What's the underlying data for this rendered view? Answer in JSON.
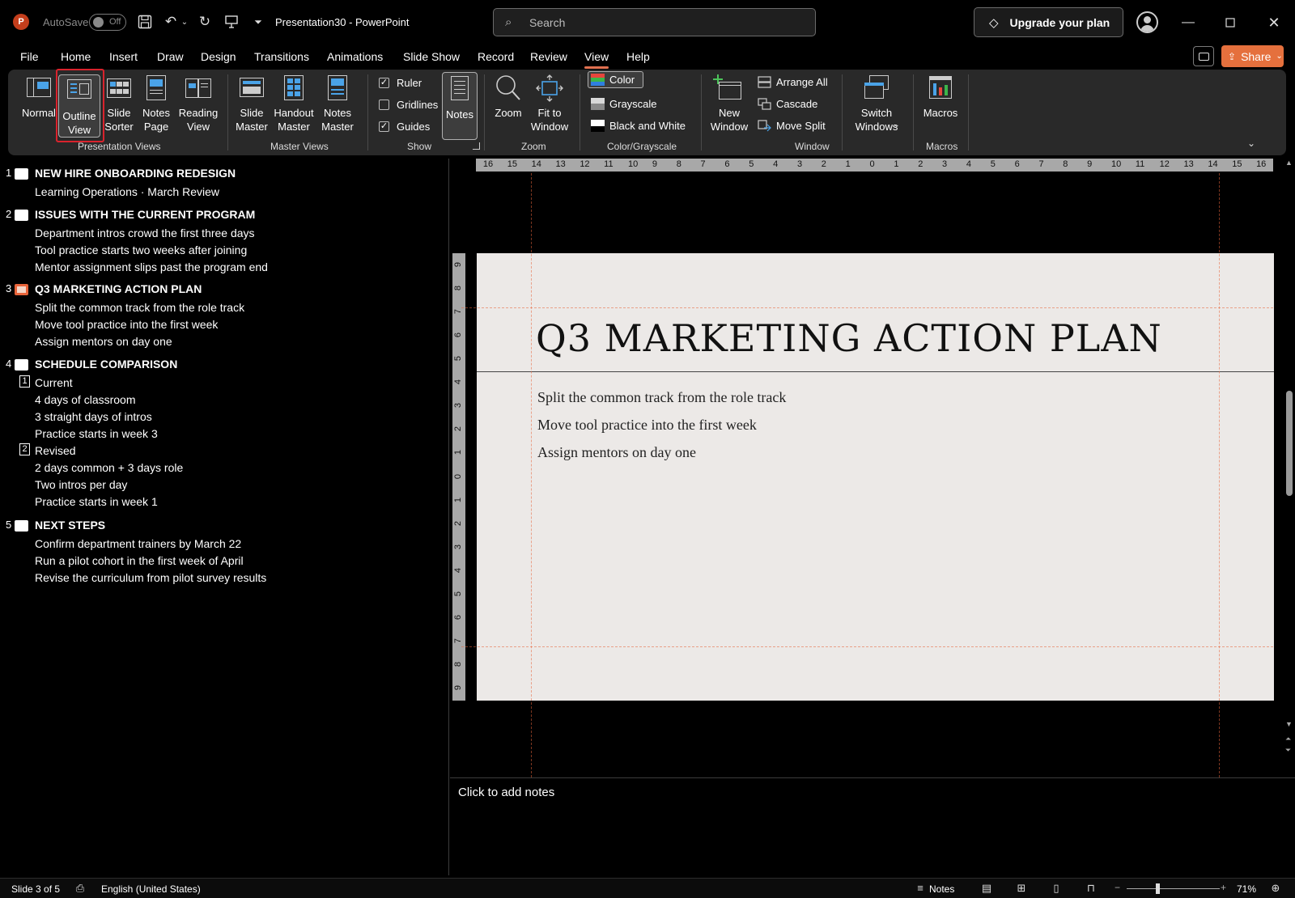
{
  "titlebar": {
    "app_badge": "P",
    "autosave_label": "AutoSave",
    "autosave_state": "Off",
    "document_title": "Presentation30  -  PowerPoint",
    "search_placeholder": "Search",
    "upgrade_label": "Upgrade your plan",
    "icons": [
      "save-icon",
      "undo-icon",
      "redo-icon",
      "present-icon",
      "customize-qat-icon",
      "search-icon",
      "diamond-icon",
      "avatar",
      "minimize-icon",
      "maximize-icon",
      "close-icon"
    ]
  },
  "menu": {
    "tabs": [
      "File",
      "Home",
      "Insert",
      "Draw",
      "Design",
      "Transitions",
      "Animations",
      "Slide Show",
      "Record",
      "Review",
      "View",
      "Help"
    ],
    "active_tab": "View",
    "share_label": "Share"
  },
  "ribbon": {
    "presentation_views": {
      "label": "Presentation Views",
      "normal": "Normal",
      "outline": [
        "Outline",
        "View"
      ],
      "slide_sorter": [
        "Slide",
        "Sorter"
      ],
      "notes_page": [
        "Notes",
        "Page"
      ],
      "reading_view": [
        "Reading",
        "View"
      ]
    },
    "master_views": {
      "label": "Master Views",
      "slide_master": [
        "Slide",
        "Master"
      ],
      "handout_master": [
        "Handout",
        "Master"
      ],
      "notes_master": [
        "Notes",
        "Master"
      ]
    },
    "show": {
      "label": "Show",
      "ruler": "Ruler",
      "ruler_checked": true,
      "gridlines": "Gridlines",
      "gridlines_checked": false,
      "guides": "Guides",
      "guides_checked": true,
      "notes": "Notes"
    },
    "zoom": {
      "label": "Zoom",
      "zoom": "Zoom",
      "fit_to_window": [
        "Fit to",
        "Window"
      ]
    },
    "color": {
      "label": "Color/Grayscale",
      "color": "Color",
      "grayscale": "Grayscale",
      "black_white": "Black and White"
    },
    "window": {
      "label": "Window",
      "new_window": [
        "New",
        "Window"
      ],
      "arrange_all": "Arrange All",
      "cascade": "Cascade",
      "move_split": "Move Split",
      "switch_windows": [
        "Switch",
        "Windows"
      ]
    },
    "macros": {
      "label": "Macros",
      "macros": "Macros"
    }
  },
  "outline": {
    "slides": [
      {
        "num": "1",
        "title": "NEW HIRE ONBOARDING REDESIGN",
        "lines": [
          "Learning Operations · March Review"
        ]
      },
      {
        "num": "2",
        "title": "ISSUES WITH THE CURRENT PROGRAM",
        "lines": [
          "Department intros crowd the first three days",
          "Tool practice starts two weeks after joining",
          "Mentor assignment slips past the program end"
        ]
      },
      {
        "num": "3",
        "title": "Q3 MARKETING ACTION PLAN",
        "lines": [
          "Split the common track from the role track",
          "Move tool practice into the first week",
          "Assign mentors on day one"
        ]
      },
      {
        "num": "4",
        "title": "SCHEDULE COMPARISON",
        "box1": "1",
        "group1_title": "Current",
        "group1_lines": [
          "4 days of classroom",
          "3 straight days of intros",
          "Practice starts in week 3"
        ],
        "box2": "2",
        "group2_title": "Revised",
        "group2_lines": [
          "2 days common + 3 days role",
          "Two intros per day",
          "Practice starts in week 1"
        ]
      },
      {
        "num": "5",
        "title": "NEXT STEPS",
        "lines": [
          "Confirm department trainers by March 22",
          "Run a pilot cohort in the first week of April",
          "Revise the curriculum from pilot survey results"
        ]
      }
    ]
  },
  "slide": {
    "title": "Q3 MARKETING ACTION PLAN",
    "bullets": [
      "Split the common track from the role track",
      "Move tool practice into the first week",
      "Assign mentors on day one"
    ]
  },
  "rulers": {
    "horizontal": [
      "16",
      "15",
      "14",
      "13",
      "12",
      "11",
      "10",
      "9",
      "8",
      "7",
      "6",
      "5",
      "4",
      "3",
      "2",
      "1",
      "0",
      "1",
      "2",
      "3",
      "4",
      "5",
      "6",
      "7",
      "8",
      "9",
      "10",
      "11",
      "12",
      "13",
      "14",
      "15",
      "16"
    ],
    "vertical": [
      "9",
      "8",
      "7",
      "6",
      "5",
      "4",
      "3",
      "2",
      "1",
      "0",
      "1",
      "2",
      "3",
      "4",
      "5",
      "6",
      "7",
      "8",
      "9"
    ]
  },
  "notes": {
    "placeholder": "Click to add notes"
  },
  "status": {
    "slide_counter": "Slide 3 of 5",
    "language": "English (United States)",
    "notes_label": "Notes",
    "zoom_minus": "−",
    "zoom_plus": "+",
    "zoom_level": "71%"
  },
  "colors": {
    "accent": "#e07050",
    "share": "#e5703d",
    "highlight": "#d9232d",
    "current_slide_icon": "#e8643a"
  }
}
